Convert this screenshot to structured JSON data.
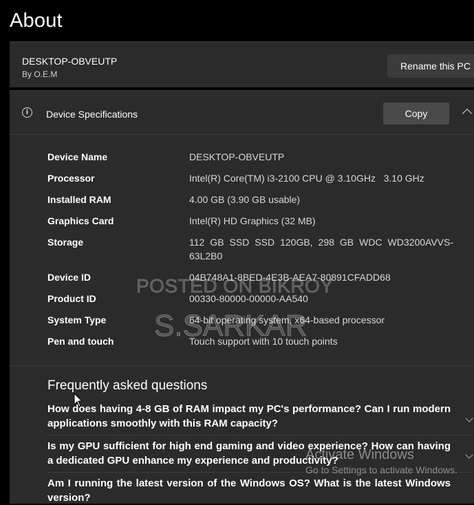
{
  "page": {
    "title": "About"
  },
  "pc": {
    "name": "DESKTOP-OBVEUTP",
    "by": "By O.E.M",
    "rename_button": "Rename this PC"
  },
  "specs": {
    "header_title": "Device Specifications",
    "copy_button": "Copy",
    "icons": {
      "info": "info-icon",
      "collapse": "chevron-up-icon"
    },
    "rows": [
      {
        "label": "Device Name",
        "value": "DESKTOP-OBVEUTP"
      },
      {
        "label": "Processor",
        "value": "Intel(R) Core(TM) i3-2100 CPU @ 3.10GHz   3.10 GHz"
      },
      {
        "label": "Installed RAM",
        "value": "4.00 GB (3.90 GB usable)"
      },
      {
        "label": "Graphics Card",
        "value": "Intel(R) HD Graphics (32 MB)"
      },
      {
        "label": "Storage",
        "value": "112 GB SSD SSD 120GB, 298 GB WDC WD3200AVVS-63L2B0"
      },
      {
        "label": "Device ID",
        "value": "04B748A1-8BED-4E3B-AEA7-80891CFADD68"
      },
      {
        "label": "Product ID",
        "value": "00330-80000-00000-AA540"
      },
      {
        "label": "System Type",
        "value": "64-bit operating system, x64-based processor"
      },
      {
        "label": "Pen and touch",
        "value": "Touch support with 10 touch points"
      }
    ]
  },
  "faq": {
    "title": "Frequently asked questions",
    "items": [
      {
        "question": "How does having 4-8 GB of RAM impact my PC's performance? Can I run modern applications smoothly with this RAM capacity?"
      },
      {
        "question": "Is my GPU sufficient for high end gaming and video experience? How can having a dedicated GPU enhance my experience and productivity?"
      },
      {
        "question": "Am I running the latest version of the Windows OS? What is the latest Windows version?"
      }
    ]
  },
  "watermarks": {
    "line1": "POSTED ON BIKROY",
    "line2": "S.SARKAR"
  },
  "activation": {
    "title": "Activate Windows",
    "subtitle": "Go to Settings to activate Windows."
  },
  "colors": {
    "background": "#000000",
    "card": "#2b2b2b",
    "button": "#3b3b3b",
    "copy_button": "#4a4a4a",
    "text_secondary": "#d8d8d8"
  }
}
